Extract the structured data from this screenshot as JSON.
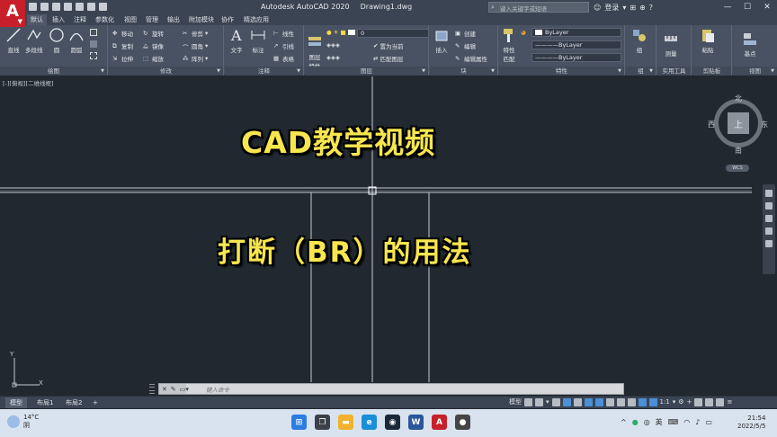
{
  "app": {
    "logo_letter": "A",
    "title": "Autodesk AutoCAD 2020",
    "document": "Drawing1.dwg",
    "search_placeholder": "键入关键字或短语",
    "login": "登录"
  },
  "ribbon_tabs": [
    "默认",
    "插入",
    "注释",
    "参数化",
    "视图",
    "管理",
    "输出",
    "附加模块",
    "协作",
    "精选应用"
  ],
  "ribbon": {
    "draw": {
      "title": "绘图",
      "line": "直线",
      "polyline": "多段线",
      "circle": "圆",
      "arc": "圆弧"
    },
    "modify": {
      "title": "修改",
      "move": "移动",
      "rotate": "旋转",
      "trim": "修剪",
      "copy": "复制",
      "mirror": "镜像",
      "fillet": "圆角",
      "stretch": "拉伸",
      "scale": "缩放",
      "array": "阵列"
    },
    "annotation": {
      "title": "注释",
      "text": "文字",
      "dimension": "标注",
      "linear": "线性",
      "leader": "引线",
      "table": "表格"
    },
    "layers": {
      "title": "图层",
      "props": "图层\n特性",
      "current_layer": "0",
      "make_current": "置为当前",
      "match_layer": "匹配图层"
    },
    "block": {
      "title": "块",
      "insert": "插入",
      "create": "创建",
      "edit": "编辑",
      "edit_attr": "编辑属性"
    },
    "properties": {
      "title": "特性",
      "match": "特性\n匹配",
      "color": "ByLayer",
      "linetype": "ByLayer",
      "lineweight": "ByLayer"
    },
    "groups": {
      "title": "组",
      "group": "组"
    },
    "utilities": {
      "title": "实用工具",
      "measure": "测量"
    },
    "clipboard": {
      "title": "剪贴板",
      "paste": "粘贴"
    },
    "view": {
      "title": "视图",
      "base": "基点"
    }
  },
  "viewport": {
    "label": "[-][俯视][二维线框]"
  },
  "overlay": {
    "title": "CAD教学视频",
    "subtitle": "打断（BR）的用法"
  },
  "viewcube": {
    "top": "上",
    "north": "北",
    "south": "南",
    "west": "西",
    "east": "东",
    "wcs": "WCS"
  },
  "ucs": {
    "y": "Y",
    "x": "X"
  },
  "command": {
    "placeholder": "键入命令"
  },
  "layout_tabs": [
    "模型",
    "布局1",
    "布局2"
  ],
  "status": {
    "model": "模型",
    "scale": "1:1"
  },
  "taskbar": {
    "temp": "14°C",
    "weather": "阴",
    "ime": "英",
    "time": "21:54",
    "date": "2022/5/5"
  },
  "colors": {
    "overlay_text": "#f7e64e",
    "canvas": "#212830",
    "ribbon": "#485262",
    "accent_red": "#c8202a"
  }
}
